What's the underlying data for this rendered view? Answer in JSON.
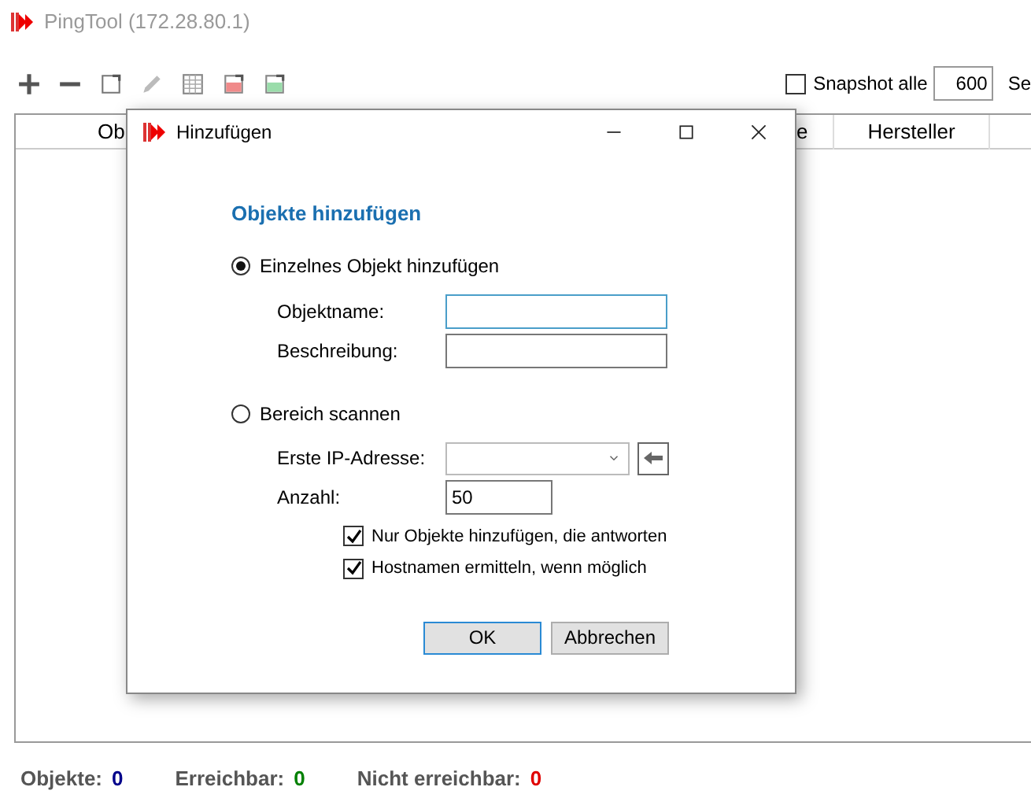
{
  "window": {
    "title": "PingTool (172.28.80.1)"
  },
  "toolbar": {
    "snapshot": {
      "label": "Snapshot alle",
      "checked": false,
      "value": "600",
      "unit": "Se"
    }
  },
  "table": {
    "columns": [
      "Ob",
      "e",
      "Hersteller"
    ]
  },
  "status_bar": [
    {
      "label": "Objekte:",
      "value": "0",
      "color": "#00008b"
    },
    {
      "label": "Erreichbar:",
      "value": "0",
      "color": "#008000"
    },
    {
      "label": "Nicht erreichbar:",
      "value": "0",
      "color": "#e00000"
    }
  ],
  "dialog": {
    "title": "Hinzufügen",
    "heading": "Objekte hinzufügen",
    "modes": [
      {
        "label": "Einzelnes Objekt hinzufügen",
        "selected": true
      },
      {
        "label": "Bereich scannen",
        "selected": false
      }
    ],
    "single_fields": [
      {
        "label": "Objektname:",
        "focused": true
      },
      {
        "label": "Beschreibung:",
        "focused": false
      }
    ],
    "range": {
      "first_ip_label": "Erste IP-Adresse:",
      "count_label": "Anzahl:",
      "count": "50",
      "options": [
        {
          "label": "Nur Objekte hinzufügen, die antworten",
          "checked": true
        },
        {
          "label": "Hostnamen ermitteln, wenn möglich",
          "checked": true
        }
      ]
    },
    "buttons": [
      {
        "label": "OK",
        "default": true
      },
      {
        "label": "Abbrechen",
        "default": false
      }
    ]
  }
}
